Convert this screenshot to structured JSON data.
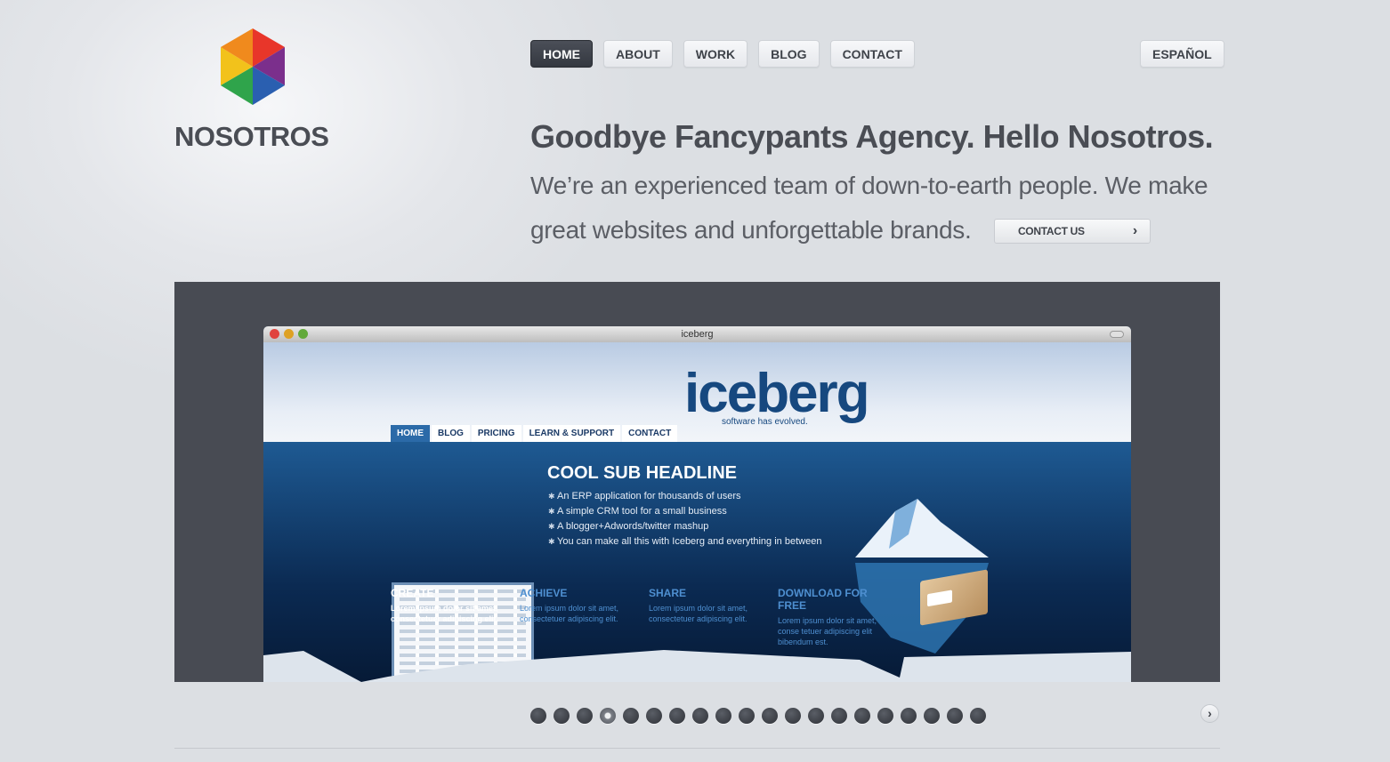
{
  "brand": {
    "name": "NOSOTROS",
    "logo_icon": "hexagon-cube-icon"
  },
  "nav": [
    {
      "label": "HOME",
      "active": true
    },
    {
      "label": "ABOUT"
    },
    {
      "label": "WORK"
    },
    {
      "label": "BLOG"
    },
    {
      "label": "CONTACT"
    }
  ],
  "language": {
    "label": "ESPAÑOL"
  },
  "hero": {
    "headline": "Goodbye Fancypants Agency. Hello Nosotros.",
    "intro": "We’re an experienced team of down-to-earth people. We make great websites and unforgettable brands.",
    "cta_label": "CONTACT US",
    "cta_icon": "chevron-right-icon"
  },
  "slide": {
    "window_title": "iceberg",
    "site_logo": "iceberg",
    "site_tagline": "software has evolved.",
    "site_nav": [
      "HOME",
      "BLOG",
      "PRICING",
      "LEARN & SUPPORT",
      "CONTACT"
    ],
    "sub_headline": "COOL SUB HEADLINE",
    "bullets": [
      "An ERP application for thousands of users",
      "A simple CRM tool for a small business",
      "A blogger+Adwords/twitter mashup",
      "You can make all this with Iceberg and everything in between"
    ],
    "columns": [
      {
        "title": "CREATE",
        "text": "Lorem ipsum dolor sit amet, consectetuer adipiscing elit."
      },
      {
        "title": "ACHIEVE",
        "text": "Lorem ipsum dolor sit amet, consectetuer adipiscing elit."
      },
      {
        "title": "SHARE",
        "text": "Lorem ipsum dolor sit amet, consectetuer adipiscing elit."
      },
      {
        "title": "DOWNLOAD FOR FREE",
        "text": "Lorem ipsum dolor sit amet, conse tetuer adipiscing elit bibendum est."
      }
    ]
  },
  "slider": {
    "total": 20,
    "active_index": 3,
    "next_icon": "chevron-right-icon"
  },
  "colors": {
    "background": "#dcdfe3",
    "active_nav": "#3b3f47",
    "showcase": "#484b53",
    "iceberg_blue": "#16487f"
  }
}
